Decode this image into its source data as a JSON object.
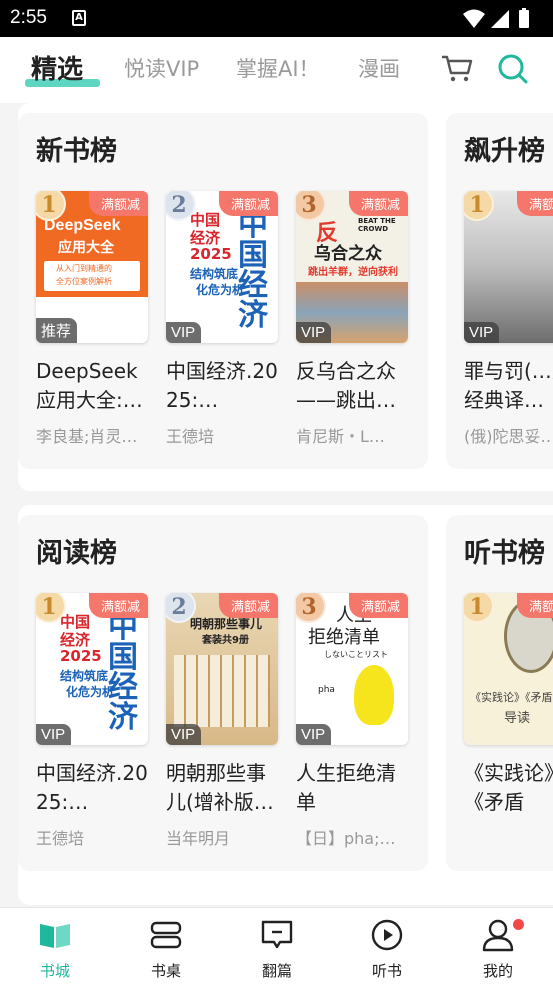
{
  "status_bar": {
    "time": "2:55",
    "app_indicator": "A"
  },
  "tabs": [
    {
      "label": "精选",
      "active": true
    },
    {
      "label": "悦读VIP",
      "active": false
    },
    {
      "label": "掌握AI！",
      "active": false
    },
    {
      "label": "漫画",
      "active": false
    }
  ],
  "icons": {
    "cart": "cart-icon",
    "search": "search-icon"
  },
  "accent_color": "#1fb89c",
  "sections": [
    {
      "panels": [
        {
          "title": "新书榜",
          "books": [
            {
              "rank": "1",
              "promo": "满额减",
              "badge": "推荐",
              "title": "DeepSeek应用大全:…",
              "author": "李良基;肖灵…",
              "cover_text": [
                "DeepSeek",
                "应用大全",
                "从入门到精通的",
                "全方位案例解析"
              ]
            },
            {
              "rank": "2",
              "promo": "满额减",
              "badge": "VIP",
              "title": "中国经济.2025:…",
              "author": "王德培",
              "cover_text": [
                "中国",
                "经济",
                "2025",
                "结构筑底",
                "化危为机"
              ]
            },
            {
              "rank": "3",
              "promo": "满额减",
              "badge": "VIP",
              "title": "反乌合之众——跳出…",
              "author": "肯尼斯・L…",
              "cover_text": [
                "反",
                "乌合之众",
                "BEAT THE CROWD",
                "跳出羊群，逆向获利"
              ]
            }
          ]
        },
        {
          "title": "飙升榜",
          "books": [
            {
              "rank": "1",
              "promo": "满额减",
              "badge": "VIP",
              "title": "罪与罚(…之经典译…",
              "author": "(俄)陀思妥…"
            }
          ]
        }
      ]
    },
    {
      "panels": [
        {
          "title": "阅读榜",
          "books": [
            {
              "rank": "1",
              "promo": "满额减",
              "badge": "VIP",
              "title": "中国经济.2025:…",
              "author": "王德培",
              "cover_text": [
                "中国",
                "经济",
                "2025",
                "结构筑底",
                "化危为机"
              ]
            },
            {
              "rank": "2",
              "promo": "满额减",
              "badge": "VIP",
              "title": "明朝那些事儿(增补版…",
              "author": "当年明月",
              "cover_text": [
                "明朝那些事儿",
                "套装共9册"
              ]
            },
            {
              "rank": "3",
              "promo": "满额减",
              "badge": "VIP",
              "title": "人生拒绝清单",
              "author": "【日】pha;…",
              "cover_text": [
                "人生",
                "拒绝清单",
                "しないことリスト",
                "pha"
              ]
            }
          ]
        },
        {
          "title": "听书榜",
          "books": [
            {
              "rank": "1",
              "promo": "满额减",
              "badge": "",
              "title": "《实践论》《矛盾论》…",
              "author": "",
              "cover_text": [
                "《实践论》《矛盾论》",
                "导读"
              ]
            }
          ]
        }
      ]
    }
  ],
  "bottom_nav": [
    {
      "label": "书城",
      "active": true
    },
    {
      "label": "书桌",
      "active": false
    },
    {
      "label": "翻篇",
      "active": false
    },
    {
      "label": "听书",
      "active": false
    },
    {
      "label": "我的",
      "active": false,
      "notification": true
    }
  ]
}
